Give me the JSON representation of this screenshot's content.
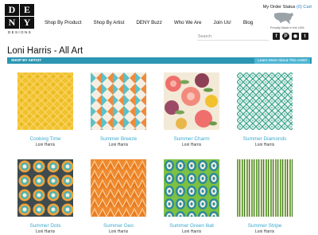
{
  "logo": {
    "letters": [
      "D",
      "E",
      "N",
      "Y"
    ],
    "subtitle": "DESIGNS"
  },
  "nav": {
    "items": [
      "Shop By Product",
      "Shop By Artist",
      "DENY Buzz",
      "Who We Are",
      "Join Us!",
      "Blog"
    ]
  },
  "header": {
    "order_status_label": "My Order Status",
    "cart_label": "(0) Cart",
    "made_in_usa": "Proudly Made in the USA",
    "search_placeholder": "Search",
    "social": [
      {
        "name": "facebook-icon",
        "glyph": "f"
      },
      {
        "name": "pinterest-icon",
        "glyph": "P"
      },
      {
        "name": "instagram-icon",
        "glyph": "◉"
      },
      {
        "name": "twitter-icon",
        "glyph": "t"
      }
    ]
  },
  "page": {
    "title": "Loni Harris - All Art",
    "subbar_label": "SHOP BY ARTIST",
    "learn_more_label": "Learn More About This Artist!"
  },
  "products": [
    {
      "name": "Cooking Time",
      "artist": "Loni Harris",
      "pattern": "cooking"
    },
    {
      "name": "Summer Breeze",
      "artist": "Loni Harris",
      "pattern": "breeze"
    },
    {
      "name": "Summer Charm",
      "artist": "Loni Harris",
      "pattern": "charm"
    },
    {
      "name": "Summer Diamonds",
      "artist": "Loni Harris",
      "pattern": "diamonds"
    },
    {
      "name": "Summer Dots",
      "artist": "Loni Harris",
      "pattern": "dots"
    },
    {
      "name": "Summer Geo",
      "artist": "Loni Harris",
      "pattern": "geo"
    },
    {
      "name": "Summer Green Ikat",
      "artist": "Loni Harris",
      "pattern": "ikat"
    },
    {
      "name": "Summer Stripe",
      "artist": "Loni Harris",
      "pattern": "stripe"
    }
  ],
  "colors": {
    "accent": "#2c96b3",
    "link": "#3aa9cf",
    "button": "#4fb6d4"
  }
}
